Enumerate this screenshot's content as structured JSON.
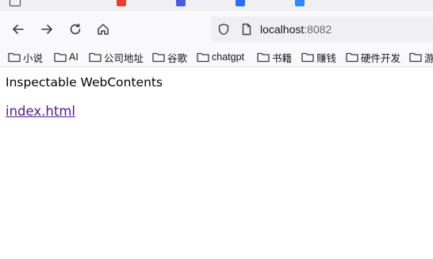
{
  "url": {
    "host": "localhost",
    "port": ":8082"
  },
  "bookmarks": [
    {
      "label": "小说"
    },
    {
      "label": "AI"
    },
    {
      "label": "公司地址"
    },
    {
      "label": "谷歌"
    },
    {
      "label": "chatgpt"
    },
    {
      "label": "书籍"
    },
    {
      "label": "赚钱"
    },
    {
      "label": "硬件开发"
    },
    {
      "label": "游"
    }
  ],
  "page": {
    "heading": "Inspectable WebContents",
    "link": "index.html"
  },
  "colors": {
    "link_visited": "#551a8b",
    "toolbar_bg": "#f9f9fb",
    "urlbar_bg": "#f0f0f4"
  }
}
